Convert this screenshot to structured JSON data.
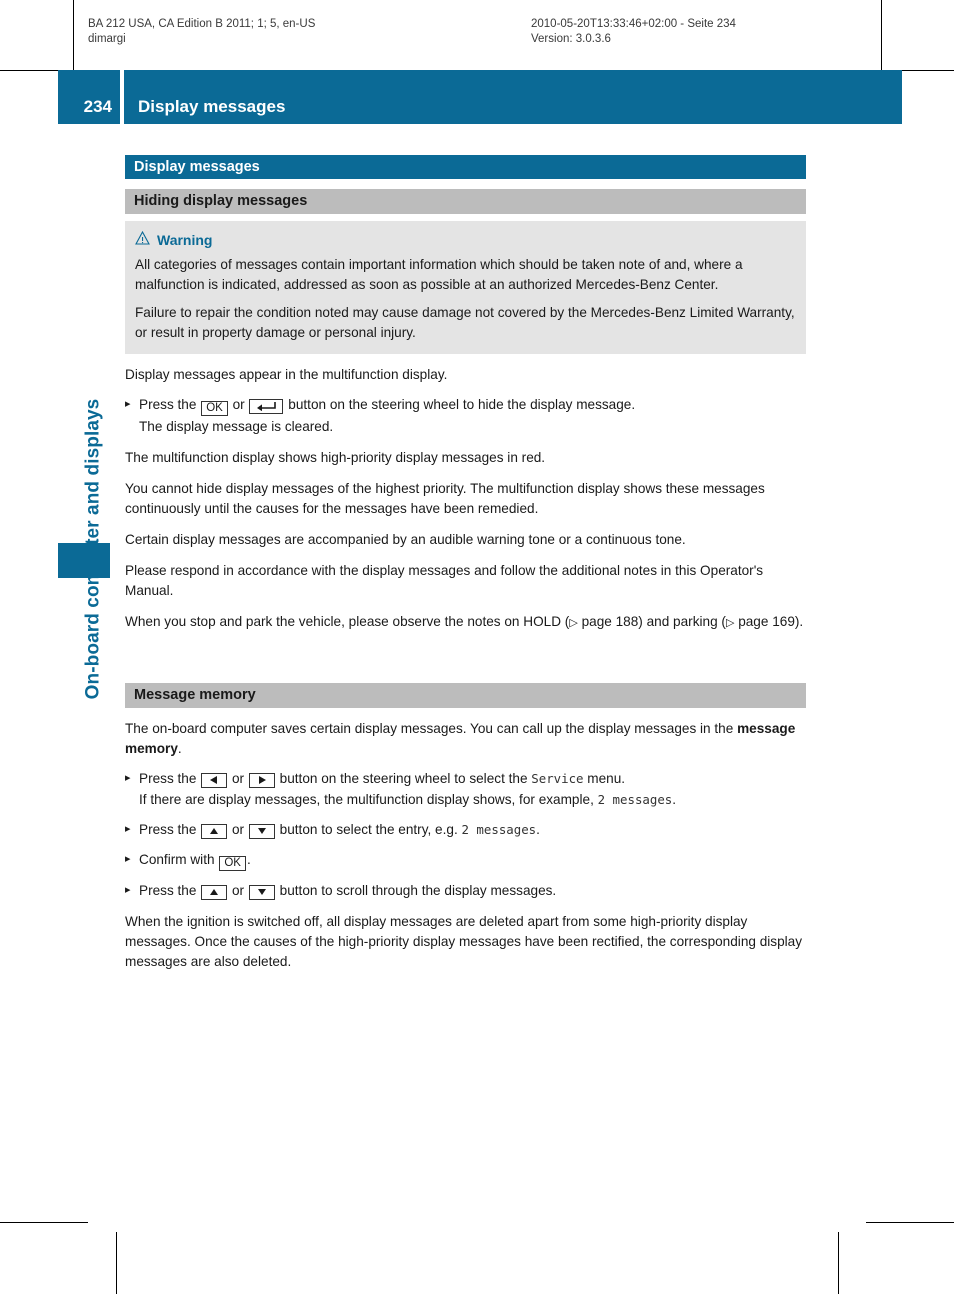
{
  "print_meta": {
    "left_line1": "BA 212 USA, CA Edition B 2011; 1; 5, en-US",
    "left_line2": "dimargi",
    "right_line1": "2010-05-20T13:33:46+02:00 - Seite 234",
    "right_line2": "Version: 3.0.3.6"
  },
  "running_head": {
    "page_number": "234",
    "title": "Display messages"
  },
  "chapter_tab": {
    "label": "On-board computer and displays"
  },
  "section": {
    "title": "Display messages",
    "subsection_1": "Hiding display messages",
    "subsection_2": "Message memory"
  },
  "warning": {
    "label": "Warning",
    "icon": "warning-triangle-icon",
    "paragraph_1": "All categories of messages contain important information which should be taken note of and, where a malfunction is indicated, addressed as soon as possible at an authorized Mercedes-Benz Center.",
    "paragraph_2": "Failure to repair the condition noted may cause damage not covered by the Mercedes-Benz Limited Warranty, or result in property damage or personal injury."
  },
  "hiding": {
    "intro": "Display messages appear in the multifunction display.",
    "step_1": {
      "press_the": "Press the",
      "key_ok": "OK",
      "or": "or",
      "key_back": "back-arrow-icon",
      "rest": "button on the steering wheel to hide the display message.",
      "result": "The display message is cleared."
    },
    "para_1": "The multifunction display shows high-priority display messages in red.",
    "para_2": "You cannot hide display messages of the highest priority. The multifunction display shows these messages continuously until the causes for the messages have been remedied.",
    "para_3": "Certain display messages are accompanied by an audible warning tone or a continuous tone.",
    "para_4": "Please respond in accordance with the display messages and follow the additional notes in this Operator's Manual.",
    "para_5_a": "When you stop and park the vehicle, please observe the notes on HOLD (",
    "para_5_ref1": "page 188",
    "para_5_b": ") and parking (",
    "para_5_ref2": "page 169",
    "para_5_c": ")."
  },
  "memory": {
    "intro_a": "The on-board computer saves certain display messages. You can call up the display messages in the ",
    "intro_bold": "message memory",
    "intro_b": ".",
    "step_1": {
      "press_the": "Press the",
      "key_left": "left-arrow-icon",
      "or": "or",
      "key_right": "right-arrow-icon",
      "rest_a": "button on the steering wheel to select the",
      "menu_name": "Service",
      "rest_b": "menu.",
      "result_a": "If there are display messages, the multifunction display shows, for example,",
      "result_value": "2 messages",
      "result_b": "."
    },
    "step_2": {
      "press_the": "Press the",
      "key_up": "up-arrow-icon",
      "or": "or",
      "key_down": "down-arrow-icon",
      "rest_a": "button to select the entry, e.g.",
      "entry_value": "2 messages",
      "rest_b": "."
    },
    "step_3": {
      "confirm_with": "Confirm with",
      "key_ok": "OK",
      "period": "."
    },
    "step_4": {
      "press_the": "Press the",
      "key_up": "up-arrow-icon",
      "or": "or",
      "key_down": "down-arrow-icon",
      "rest": "button to scroll through the display messages."
    },
    "outro": "When the ignition is switched off, all display messages are deleted apart from some high-priority display messages. Once the causes of the high-priority display messages have been rectified, the corresponding display messages are also deleted."
  },
  "colors": {
    "brand_blue": "#0b6a96",
    "subsection_gray": "#bcbcbc",
    "warnbox_gray": "#e4e4e4"
  }
}
